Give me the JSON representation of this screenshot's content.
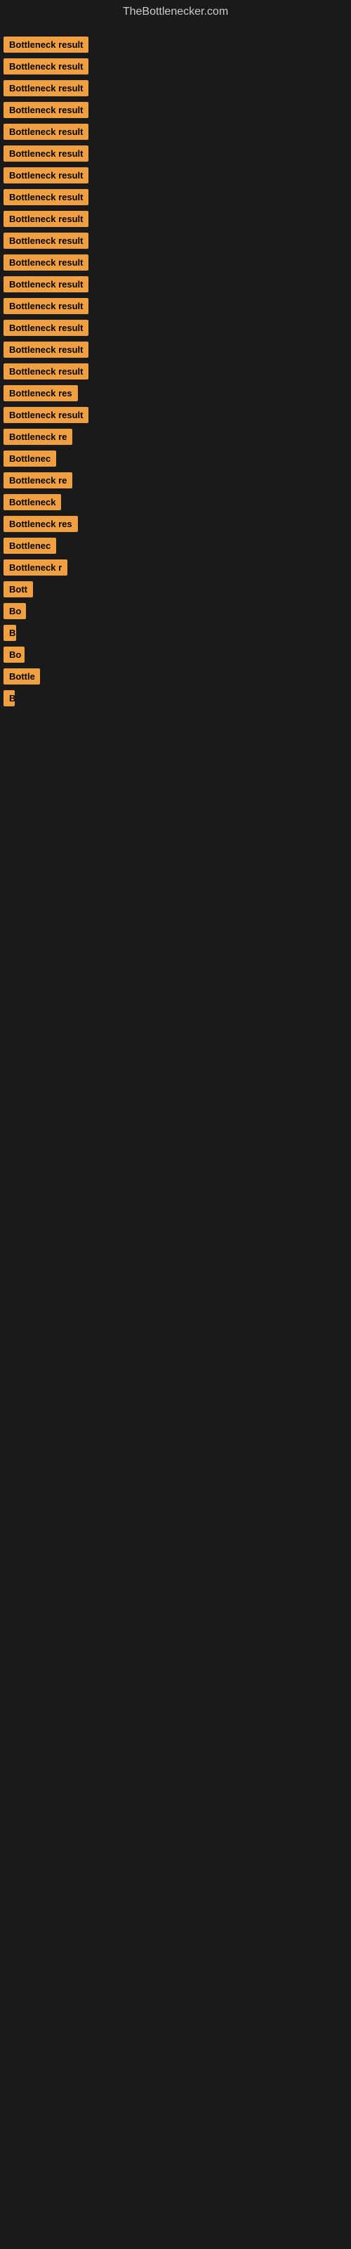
{
  "site": {
    "title": "TheBottlenecker.com"
  },
  "items": [
    {
      "id": 1,
      "label": "Bottleneck result",
      "width": 145
    },
    {
      "id": 2,
      "label": "Bottleneck result",
      "width": 145
    },
    {
      "id": 3,
      "label": "Bottleneck result",
      "width": 145
    },
    {
      "id": 4,
      "label": "Bottleneck result",
      "width": 145
    },
    {
      "id": 5,
      "label": "Bottleneck result",
      "width": 145
    },
    {
      "id": 6,
      "label": "Bottleneck result",
      "width": 145
    },
    {
      "id": 7,
      "label": "Bottleneck result",
      "width": 145
    },
    {
      "id": 8,
      "label": "Bottleneck result",
      "width": 145
    },
    {
      "id": 9,
      "label": "Bottleneck result",
      "width": 145
    },
    {
      "id": 10,
      "label": "Bottleneck result",
      "width": 145
    },
    {
      "id": 11,
      "label": "Bottleneck result",
      "width": 145
    },
    {
      "id": 12,
      "label": "Bottleneck result",
      "width": 145
    },
    {
      "id": 13,
      "label": "Bottleneck result",
      "width": 145
    },
    {
      "id": 14,
      "label": "Bottleneck result",
      "width": 145
    },
    {
      "id": 15,
      "label": "Bottleneck result",
      "width": 145
    },
    {
      "id": 16,
      "label": "Bottleneck result",
      "width": 145
    },
    {
      "id": 17,
      "label": "Bottleneck res",
      "width": 120
    },
    {
      "id": 18,
      "label": "Bottleneck result",
      "width": 145
    },
    {
      "id": 19,
      "label": "Bottleneck re",
      "width": 110
    },
    {
      "id": 20,
      "label": "Bottlenec",
      "width": 85
    },
    {
      "id": 21,
      "label": "Bottleneck re",
      "width": 110
    },
    {
      "id": 22,
      "label": "Bottleneck",
      "width": 90
    },
    {
      "id": 23,
      "label": "Bottleneck res",
      "width": 118
    },
    {
      "id": 24,
      "label": "Bottlenec",
      "width": 82
    },
    {
      "id": 25,
      "label": "Bottleneck r",
      "width": 100
    },
    {
      "id": 26,
      "label": "Bott",
      "width": 48
    },
    {
      "id": 27,
      "label": "Bo",
      "width": 32
    },
    {
      "id": 28,
      "label": "B",
      "width": 18
    },
    {
      "id": 29,
      "label": "Bo",
      "width": 30
    },
    {
      "id": 30,
      "label": "Bottle",
      "width": 52
    },
    {
      "id": 31,
      "label": "B",
      "width": 14
    }
  ]
}
